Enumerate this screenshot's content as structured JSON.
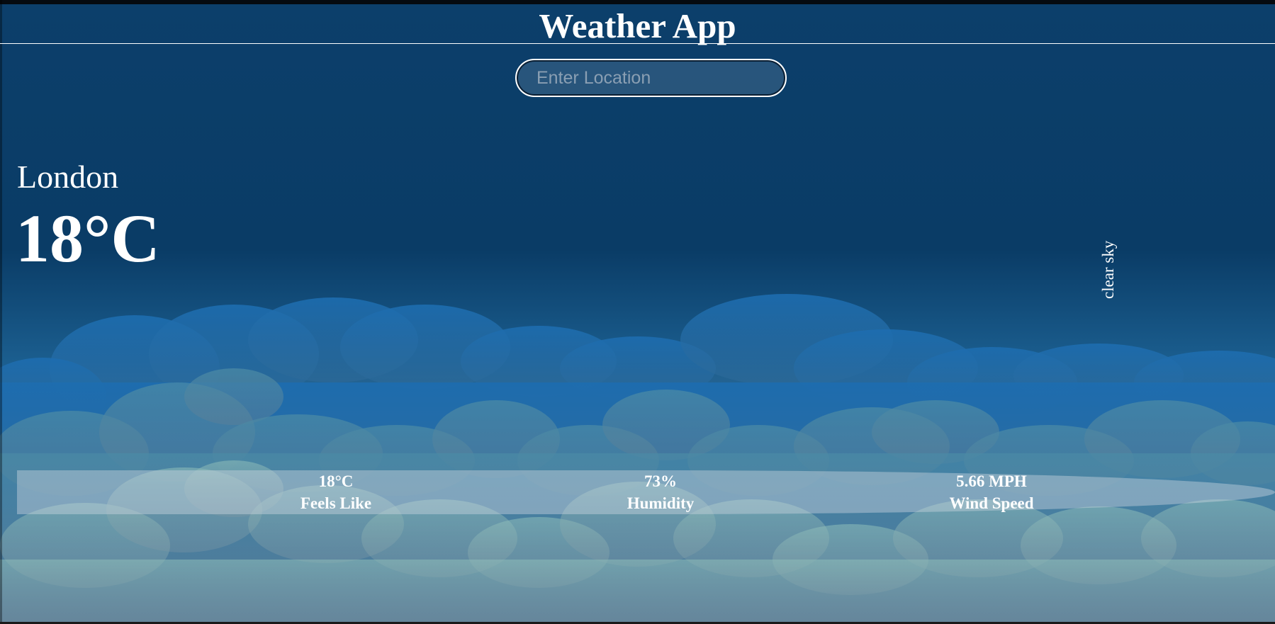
{
  "app": {
    "title": "Weather App"
  },
  "search": {
    "placeholder": "Enter Location",
    "value": ""
  },
  "current": {
    "location": "London",
    "temperature": "18°C",
    "description": "clear sky"
  },
  "stats": {
    "feels_like": {
      "value": "18°C",
      "label": "Feels Like"
    },
    "humidity": {
      "value": "73%",
      "label": "Humidity"
    },
    "wind_speed": {
      "value": "5.66 MPH",
      "label": "Wind Speed"
    }
  },
  "colors": {
    "sky_top": "#0c3f6b",
    "sky_bottom": "#8e8e8e",
    "cloud_dark": "#1a6aa8",
    "cloud_light": "#9cc7c7",
    "text": "#ffffff"
  }
}
